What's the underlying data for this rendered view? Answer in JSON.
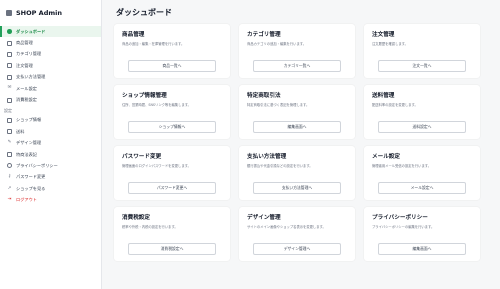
{
  "app": {
    "title": "SHOP Admin"
  },
  "sidebar": {
    "section_label": "設定",
    "items": [
      {
        "label": "ダッシュボード",
        "icon": "dashboard-icon"
      },
      {
        "label": "商品管理",
        "icon": "box-icon"
      },
      {
        "label": "カテゴリ管理",
        "icon": "tag-icon"
      },
      {
        "label": "注文管理",
        "icon": "cart-icon"
      },
      {
        "label": "支払い方法管理",
        "icon": "credit-card-icon"
      },
      {
        "label": "メール設定",
        "icon": "mail-icon"
      },
      {
        "label": "消費税設定",
        "icon": "tax-icon"
      }
    ],
    "settings_items": [
      {
        "label": "ショップ情報",
        "icon": "store-icon"
      },
      {
        "label": "送料",
        "icon": "truck-icon"
      },
      {
        "label": "デザイン管理",
        "icon": "brush-icon"
      },
      {
        "label": "特商法表記",
        "icon": "document-icon"
      },
      {
        "label": "プライバシーポリシー",
        "icon": "shield-icon"
      },
      {
        "label": "パスワード変更",
        "icon": "key-icon"
      }
    ],
    "footer_items": [
      {
        "label": "ショップを見る",
        "icon": "external-link-icon"
      },
      {
        "label": "ログアウト",
        "icon": "logout-icon"
      }
    ],
    "active_color": "#22a05a",
    "logout_color": "#dc2626"
  },
  "main": {
    "title": "ダッシュボード",
    "cards": [
      {
        "title": "商品管理",
        "desc": "商品の追加・編集・在庫管理を行います。",
        "button": "商品一覧へ"
      },
      {
        "title": "カテゴリ管理",
        "desc": "商品カテゴリの追加・編集を行います。",
        "button": "カテゴリ一覧へ"
      },
      {
        "title": "注文管理",
        "desc": "注文履歴を確認します。",
        "button": "注文一覧へ"
      },
      {
        "title": "ショップ情報管理",
        "desc": "住所、営業時間、SNSリンク等を編集します。",
        "button": "ショップ情報へ"
      },
      {
        "title": "特定商取引法",
        "desc": "特定商取引法に基づく表記を管理します。",
        "button": "編集画面へ"
      },
      {
        "title": "送料管理",
        "desc": "配送料率の設定を変更します。",
        "button": "送料設定へ"
      },
      {
        "title": "パスワード変更",
        "desc": "管理画面のログインパスワードを変更します。",
        "button": "パスワード変更へ"
      },
      {
        "title": "支払い方法管理",
        "desc": "銀行振込や代金引換などの設定を行います。",
        "button": "支払い方法管理へ"
      },
      {
        "title": "メール設定",
        "desc": "管理者用メール受信の設定を行います。",
        "button": "メール設定へ"
      },
      {
        "title": "消費税設定",
        "desc": "税率や外税・内税の設定を行います。",
        "button": "消費税設定へ"
      },
      {
        "title": "デザイン管理",
        "desc": "サイトのメイン画像やショップ名表示を変更します。",
        "button": "デザイン管理へ"
      },
      {
        "title": "プライバシーポリシー",
        "desc": "プライバシーポリシーの編集を行います。",
        "button": "編集画面へ"
      }
    ]
  }
}
